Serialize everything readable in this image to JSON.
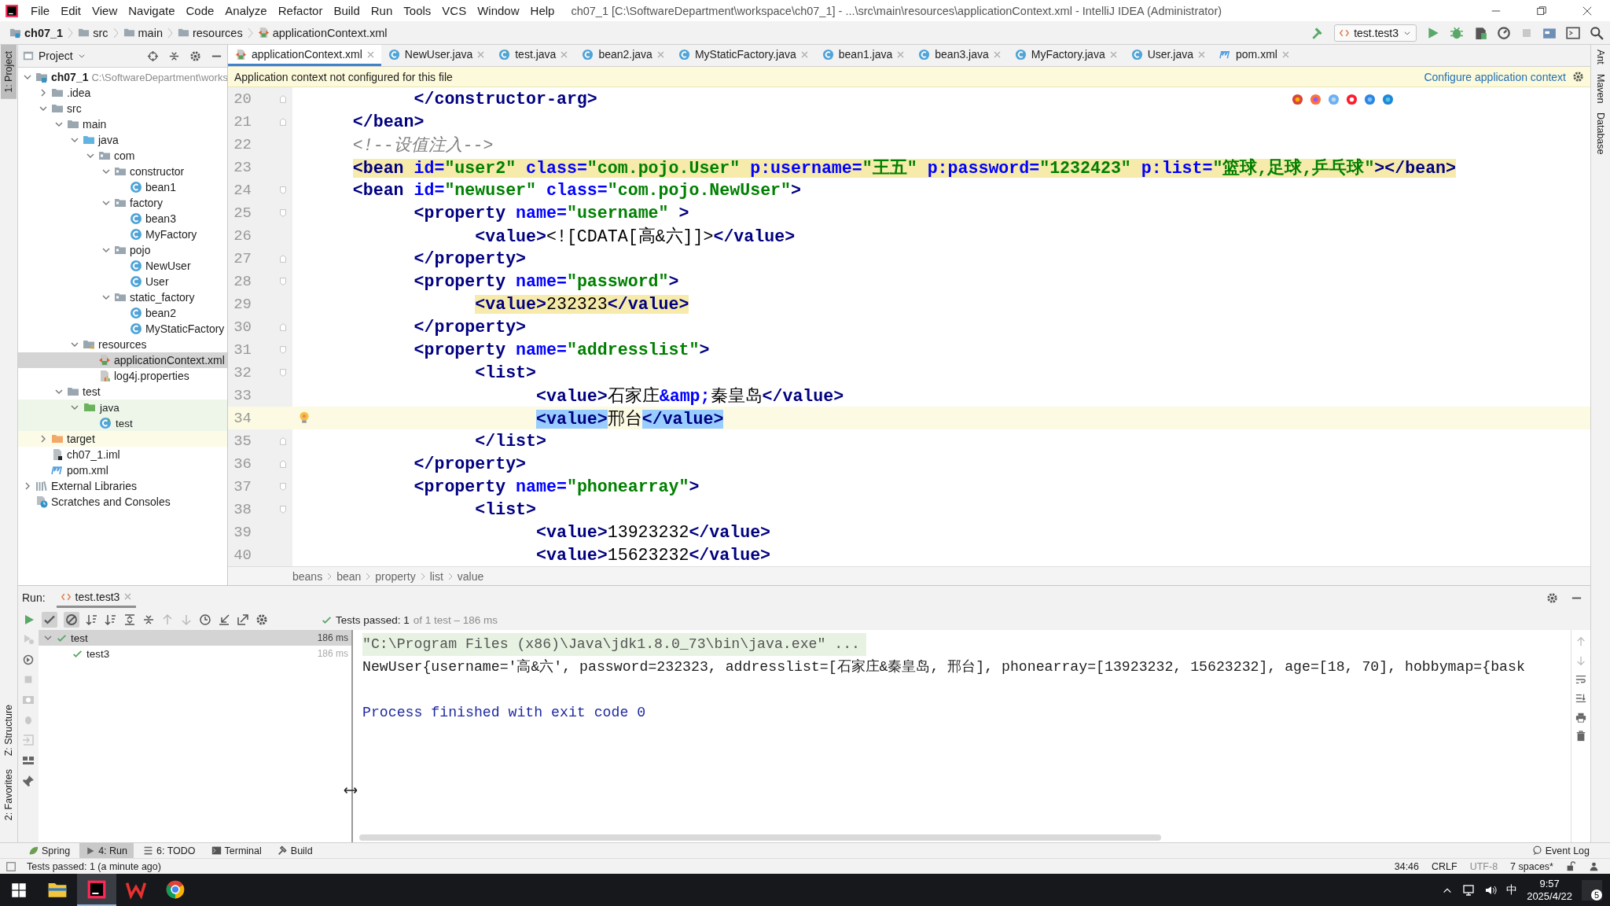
{
  "window": {
    "title": "ch07_1 [C:\\SoftwareDepartment\\workspace\\ch07_1] - ...\\src\\main\\resources\\applicationContext.xml - IntelliJ IDEA (Administrator)"
  },
  "menu": [
    "File",
    "Edit",
    "View",
    "Navigate",
    "Code",
    "Analyze",
    "Refactor",
    "Build",
    "Run",
    "Tools",
    "VCS",
    "Window",
    "Help"
  ],
  "navigation": {
    "crumbs": [
      {
        "label": "ch07_1",
        "kind": "module"
      },
      {
        "label": "src",
        "kind": "folder"
      },
      {
        "label": "main",
        "kind": "folder"
      },
      {
        "label": "resources",
        "kind": "folder"
      },
      {
        "label": "applicationContext.xml",
        "kind": "xml"
      }
    ],
    "run_config": "test.test3"
  },
  "side_tools": {
    "left": [
      {
        "label": "1: Project",
        "selected": true,
        "kind": "top"
      },
      {
        "label": "Z: Structure",
        "selected": false,
        "kind": "bottom"
      },
      {
        "label": "2: Favorites",
        "selected": false,
        "kind": "bottom"
      }
    ],
    "right": [
      {
        "label": "Ant",
        "selected": false
      },
      {
        "label": "Maven",
        "selected": false
      },
      {
        "label": "Database",
        "selected": false
      }
    ]
  },
  "project": {
    "title": "Project",
    "tree": [
      {
        "label": "ch07_1",
        "path": "C:\\SoftwareDepartment\\works",
        "kind": "module",
        "expanded": true,
        "selected": false,
        "children": [
          {
            "label": ".idea",
            "kind": "folder",
            "expanded": false,
            "selected": false
          },
          {
            "label": "src",
            "kind": "folder",
            "expanded": true,
            "selected": false,
            "children": [
              {
                "label": "main",
                "kind": "folder",
                "expanded": true,
                "selected": false,
                "children": [
                  {
                    "label": "java",
                    "kind": "source-folder",
                    "expanded": true,
                    "selected": false,
                    "children": [
                      {
                        "label": "com",
                        "kind": "package",
                        "expanded": true,
                        "selected": false,
                        "children": [
                          {
                            "label": "constructor",
                            "kind": "package",
                            "expanded": true,
                            "selected": false,
                            "children": [
                              {
                                "label": "bean1",
                                "kind": "class",
                                "selected": false
                              }
                            ]
                          },
                          {
                            "label": "factory",
                            "kind": "package",
                            "expanded": true,
                            "selected": false,
                            "children": [
                              {
                                "label": "bean3",
                                "kind": "class",
                                "selected": false
                              },
                              {
                                "label": "MyFactory",
                                "kind": "class",
                                "selected": false
                              }
                            ]
                          },
                          {
                            "label": "pojo",
                            "kind": "package",
                            "expanded": true,
                            "selected": false,
                            "children": [
                              {
                                "label": "NewUser",
                                "kind": "class",
                                "selected": false
                              },
                              {
                                "label": "User",
                                "kind": "class",
                                "selected": false
                              }
                            ]
                          },
                          {
                            "label": "static_factory",
                            "kind": "package",
                            "expanded": true,
                            "selected": false,
                            "children": [
                              {
                                "label": "bean2",
                                "kind": "class",
                                "selected": false
                              },
                              {
                                "label": "MyStaticFactory",
                                "kind": "class",
                                "selected": false
                              }
                            ]
                          }
                        ]
                      }
                    ]
                  },
                  {
                    "label": "resources",
                    "kind": "resources-folder",
                    "expanded": true,
                    "selected": false,
                    "children": [
                      {
                        "label": "applicationContext.xml",
                        "kind": "xml",
                        "selected": true
                      },
                      {
                        "label": "log4j.properties",
                        "kind": "properties",
                        "selected": false
                      }
                    ]
                  }
                ]
              },
              {
                "label": "test",
                "kind": "folder",
                "expanded": true,
                "selected": false,
                "children": [
                  {
                    "label": "java",
                    "kind": "test-folder",
                    "expanded": true,
                    "selected": false,
                    "children": [
                      {
                        "label": "test",
                        "kind": "test-class",
                        "selected": false
                      }
                    ]
                  }
                ]
              }
            ]
          },
          {
            "label": "target",
            "kind": "excluded-folder",
            "expanded": false,
            "selected": false
          },
          {
            "label": "ch07_1.iml",
            "kind": "iml",
            "selected": false
          },
          {
            "label": "pom.xml",
            "kind": "maven",
            "selected": false
          }
        ]
      },
      {
        "label": "External Libraries",
        "kind": "library",
        "expanded": false,
        "selected": false
      },
      {
        "label": "Scratches and Consoles",
        "kind": "scratches",
        "selected": false
      }
    ]
  },
  "tabs": [
    {
      "label": "applicationContext.xml",
      "kind": "xml",
      "selected": true
    },
    {
      "label": "NewUser.java",
      "kind": "class",
      "selected": false
    },
    {
      "label": "test.java",
      "kind": "test-class",
      "selected": false
    },
    {
      "label": "bean2.java",
      "kind": "class",
      "selected": false
    },
    {
      "label": "MyStaticFactory.java",
      "kind": "class",
      "selected": false
    },
    {
      "label": "bean1.java",
      "kind": "class",
      "selected": false
    },
    {
      "label": "bean3.java",
      "kind": "class",
      "selected": false
    },
    {
      "label": "MyFactory.java",
      "kind": "class",
      "selected": false
    },
    {
      "label": "User.java",
      "kind": "class",
      "selected": false
    },
    {
      "label": "pom.xml",
      "kind": "maven",
      "selected": false
    }
  ],
  "banner": {
    "message": "Application context not configured for this file",
    "action": "Configure application context"
  },
  "editor": {
    "lines": [
      {
        "number": "20",
        "kind": "fold-end",
        "current": false,
        "marked": false,
        "tag_match": false,
        "tokens": [
          {
            "kind": "tag",
            "text": "            </constructor-arg>"
          }
        ]
      },
      {
        "number": "21",
        "kind": "fold-end",
        "current": false,
        "marked": false,
        "tag_match": false,
        "tokens": [
          {
            "kind": "tag",
            "text": "      </bean>"
          }
        ]
      },
      {
        "number": "22",
        "kind": "plain",
        "current": false,
        "marked": false,
        "tag_match": false,
        "tokens": [
          {
            "kind": "comment",
            "text": "      <!--设值注入-->"
          }
        ]
      },
      {
        "number": "23",
        "kind": "plain",
        "current": false,
        "marked": true,
        "tag_match": false,
        "tokens": [
          {
            "kind": "tag",
            "text": "      <bean"
          },
          {
            "kind": "attr",
            "text": " id="
          },
          {
            "kind": "value",
            "text": "\"user2\""
          },
          {
            "kind": "attr",
            "text": " class="
          },
          {
            "kind": "value",
            "text": "\"com.pojo.User\""
          },
          {
            "kind": "attr",
            "text": " p:username="
          },
          {
            "kind": "value",
            "text": "\"王五\""
          },
          {
            "kind": "attr",
            "text": " p:password="
          },
          {
            "kind": "value",
            "text": "\"1232423\""
          },
          {
            "kind": "attr",
            "text": " p:list="
          },
          {
            "kind": "value",
            "text": "\"篮球,足球,乒乓球\""
          },
          {
            "kind": "tag",
            "text": "></bean>"
          }
        ]
      },
      {
        "number": "24",
        "kind": "fold-start",
        "current": false,
        "marked": false,
        "tag_match": false,
        "tokens": [
          {
            "kind": "tag",
            "text": "      <bean"
          },
          {
            "kind": "attr",
            "text": " id="
          },
          {
            "kind": "value",
            "text": "\"newuser\""
          },
          {
            "kind": "attr",
            "text": " class="
          },
          {
            "kind": "value",
            "text": "\"com.pojo.NewUser\""
          },
          {
            "kind": "tag",
            "text": ">"
          }
        ]
      },
      {
        "number": "25",
        "kind": "fold-start",
        "current": false,
        "marked": false,
        "tag_match": false,
        "tokens": [
          {
            "kind": "tag",
            "text": "            <property"
          },
          {
            "kind": "attr",
            "text": " name="
          },
          {
            "kind": "value",
            "text": "\"username\""
          },
          {
            "kind": "tag",
            "text": " >"
          }
        ]
      },
      {
        "number": "26",
        "kind": "plain",
        "current": false,
        "marked": false,
        "tag_match": false,
        "tokens": [
          {
            "kind": "tag",
            "text": "                  <value>"
          },
          {
            "kind": "text",
            "text": "<![CDATA[高&六]]>"
          },
          {
            "kind": "tag",
            "text": "</value>"
          }
        ]
      },
      {
        "number": "27",
        "kind": "fold-end",
        "current": false,
        "marked": false,
        "tag_match": false,
        "tokens": [
          {
            "kind": "tag",
            "text": "            </property>"
          }
        ]
      },
      {
        "number": "28",
        "kind": "fold-start",
        "current": false,
        "marked": false,
        "tag_match": false,
        "tokens": [
          {
            "kind": "tag",
            "text": "            <property"
          },
          {
            "kind": "attr",
            "text": " name="
          },
          {
            "kind": "value",
            "text": "\"password\""
          },
          {
            "kind": "tag",
            "text": ">"
          }
        ]
      },
      {
        "number": "29",
        "kind": "plain",
        "current": false,
        "marked": true,
        "tag_match": false,
        "tokens": [
          {
            "kind": "tag",
            "text": "                  <value>"
          },
          {
            "kind": "text",
            "text": "232323"
          },
          {
            "kind": "tag",
            "text": "</value>"
          }
        ]
      },
      {
        "number": "30",
        "kind": "fold-end",
        "current": false,
        "marked": false,
        "tag_match": false,
        "tokens": [
          {
            "kind": "tag",
            "text": "            </property>"
          }
        ]
      },
      {
        "number": "31",
        "kind": "fold-start",
        "current": false,
        "marked": false,
        "tag_match": false,
        "tokens": [
          {
            "kind": "tag",
            "text": "            <property"
          },
          {
            "kind": "attr",
            "text": " name="
          },
          {
            "kind": "value",
            "text": "\"addresslist\""
          },
          {
            "kind": "tag",
            "text": ">"
          }
        ]
      },
      {
        "number": "32",
        "kind": "fold-start",
        "current": false,
        "marked": false,
        "tag_match": false,
        "tokens": [
          {
            "kind": "tag",
            "text": "                  <list>"
          }
        ]
      },
      {
        "number": "33",
        "kind": "plain",
        "current": false,
        "marked": false,
        "tag_match": false,
        "tokens": [
          {
            "kind": "tag",
            "text": "                        <value>"
          },
          {
            "kind": "text",
            "text": "石家庄"
          },
          {
            "kind": "entity",
            "text": "&amp;"
          },
          {
            "kind": "text",
            "text": "秦皇岛"
          },
          {
            "kind": "tag",
            "text": "</value>"
          }
        ]
      },
      {
        "number": "34",
        "kind": "plain",
        "current": true,
        "marked": false,
        "tag_match": true,
        "tokens": [
          {
            "kind": "tag",
            "text": "                        <value>"
          },
          {
            "kind": "text",
            "text": "邢台"
          },
          {
            "kind": "tag",
            "text": "</value>"
          }
        ]
      },
      {
        "number": "35",
        "kind": "fold-end",
        "current": false,
        "marked": false,
        "tag_match": false,
        "tokens": [
          {
            "kind": "tag",
            "text": "                  </list>"
          }
        ]
      },
      {
        "number": "36",
        "kind": "fold-end",
        "current": false,
        "marked": false,
        "tag_match": false,
        "tokens": [
          {
            "kind": "tag",
            "text": "            </property>"
          }
        ]
      },
      {
        "number": "37",
        "kind": "fold-start",
        "current": false,
        "marked": false,
        "tag_match": false,
        "tokens": [
          {
            "kind": "tag",
            "text": "            <property"
          },
          {
            "kind": "attr",
            "text": " name="
          },
          {
            "kind": "value",
            "text": "\"phonearray\""
          },
          {
            "kind": "tag",
            "text": ">"
          }
        ]
      },
      {
        "number": "38",
        "kind": "fold-start",
        "current": false,
        "marked": false,
        "tag_match": false,
        "tokens": [
          {
            "kind": "tag",
            "text": "                  <list>"
          }
        ]
      },
      {
        "number": "39",
        "kind": "plain",
        "current": false,
        "marked": false,
        "tag_match": false,
        "tokens": [
          {
            "kind": "tag",
            "text": "                        <value>"
          },
          {
            "kind": "text",
            "text": "13923232"
          },
          {
            "kind": "tag",
            "text": "</value>"
          }
        ]
      },
      {
        "number": "40",
        "kind": "plain",
        "current": false,
        "marked": false,
        "tag_match": false,
        "tokens": [
          {
            "kind": "tag",
            "text": "                        <value>"
          },
          {
            "kind": "text",
            "text": "15623232"
          },
          {
            "kind": "tag",
            "text": "</value>"
          }
        ]
      }
    ],
    "breadcrumbs": [
      "beans",
      "bean",
      "property",
      "list",
      "value"
    ]
  },
  "run": {
    "label": "Run:",
    "tab": "test.test3",
    "toggles": [
      {
        "kind": "passed",
        "on": true
      },
      {
        "kind": "ignored",
        "on": true
      }
    ],
    "summary": "Tests passed: 1",
    "detail": "of 1 test – 186 ms",
    "tests": [
      {
        "name": "test",
        "time": "186 ms",
        "kind": "passed",
        "selected": true,
        "expanded": true,
        "children": [
          {
            "name": "test3",
            "time": "186 ms",
            "kind": "passed",
            "selected": false
          }
        ]
      }
    ],
    "console": [
      {
        "kind": "command",
        "text": "\"C:\\Program Files (x86)\\Java\\jdk1.8.0_73\\bin\\java.exe\" ..."
      },
      {
        "kind": "output",
        "text": "NewUser{username='高&六', password=232323, addresslist=[石家庄&秦皇岛, 邢台], phonearray=[13923232, 15623232], age=[18, 70], hobbymap={bask"
      },
      {
        "kind": "system",
        "text": "Process finished with exit code 0"
      }
    ]
  },
  "tool_tabs": [
    {
      "label": "Spring",
      "kind": "spring",
      "selected": false
    },
    {
      "label": "4: Run",
      "kind": "run",
      "selected": true
    },
    {
      "label": "6: TODO",
      "kind": "todo",
      "selected": false
    },
    {
      "label": "Terminal",
      "kind": "terminal",
      "selected": false
    },
    {
      "label": "Build",
      "kind": "build",
      "selected": false
    }
  ],
  "event_log": "Event Log",
  "status_bar": {
    "message": "Tests passed: 1 (a minute ago)",
    "position": "34:46",
    "line_separator": "CRLF",
    "encoding": "UTF-8",
    "indent": "7 spaces*"
  },
  "taskbar": {
    "apps": [
      {
        "kind": "explorer",
        "selected": false
      },
      {
        "kind": "intellij",
        "selected": true
      },
      {
        "kind": "wps",
        "selected": false
      },
      {
        "kind": "chrome",
        "selected": false
      }
    ],
    "ime": "中",
    "time": "9:57",
    "date": "2025/4/22",
    "notifications": "5"
  }
}
